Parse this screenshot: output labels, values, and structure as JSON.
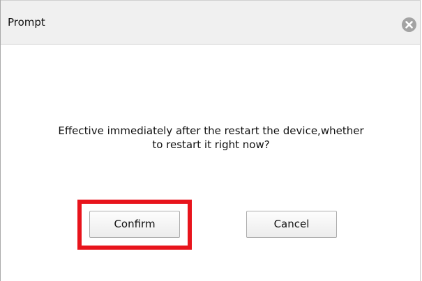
{
  "dialog": {
    "title": "Prompt",
    "close_icon": "close-circle-icon",
    "message_line1": "Effective immediately after the restart the device,whether",
    "message_line2": "to restart it right now?"
  },
  "buttons": {
    "confirm_label": "Confirm",
    "cancel_label": "Cancel"
  },
  "colors": {
    "highlight": "#e8141c",
    "titlebar": "#f0f0f0",
    "close_icon_bg": "#a3a3a3"
  }
}
